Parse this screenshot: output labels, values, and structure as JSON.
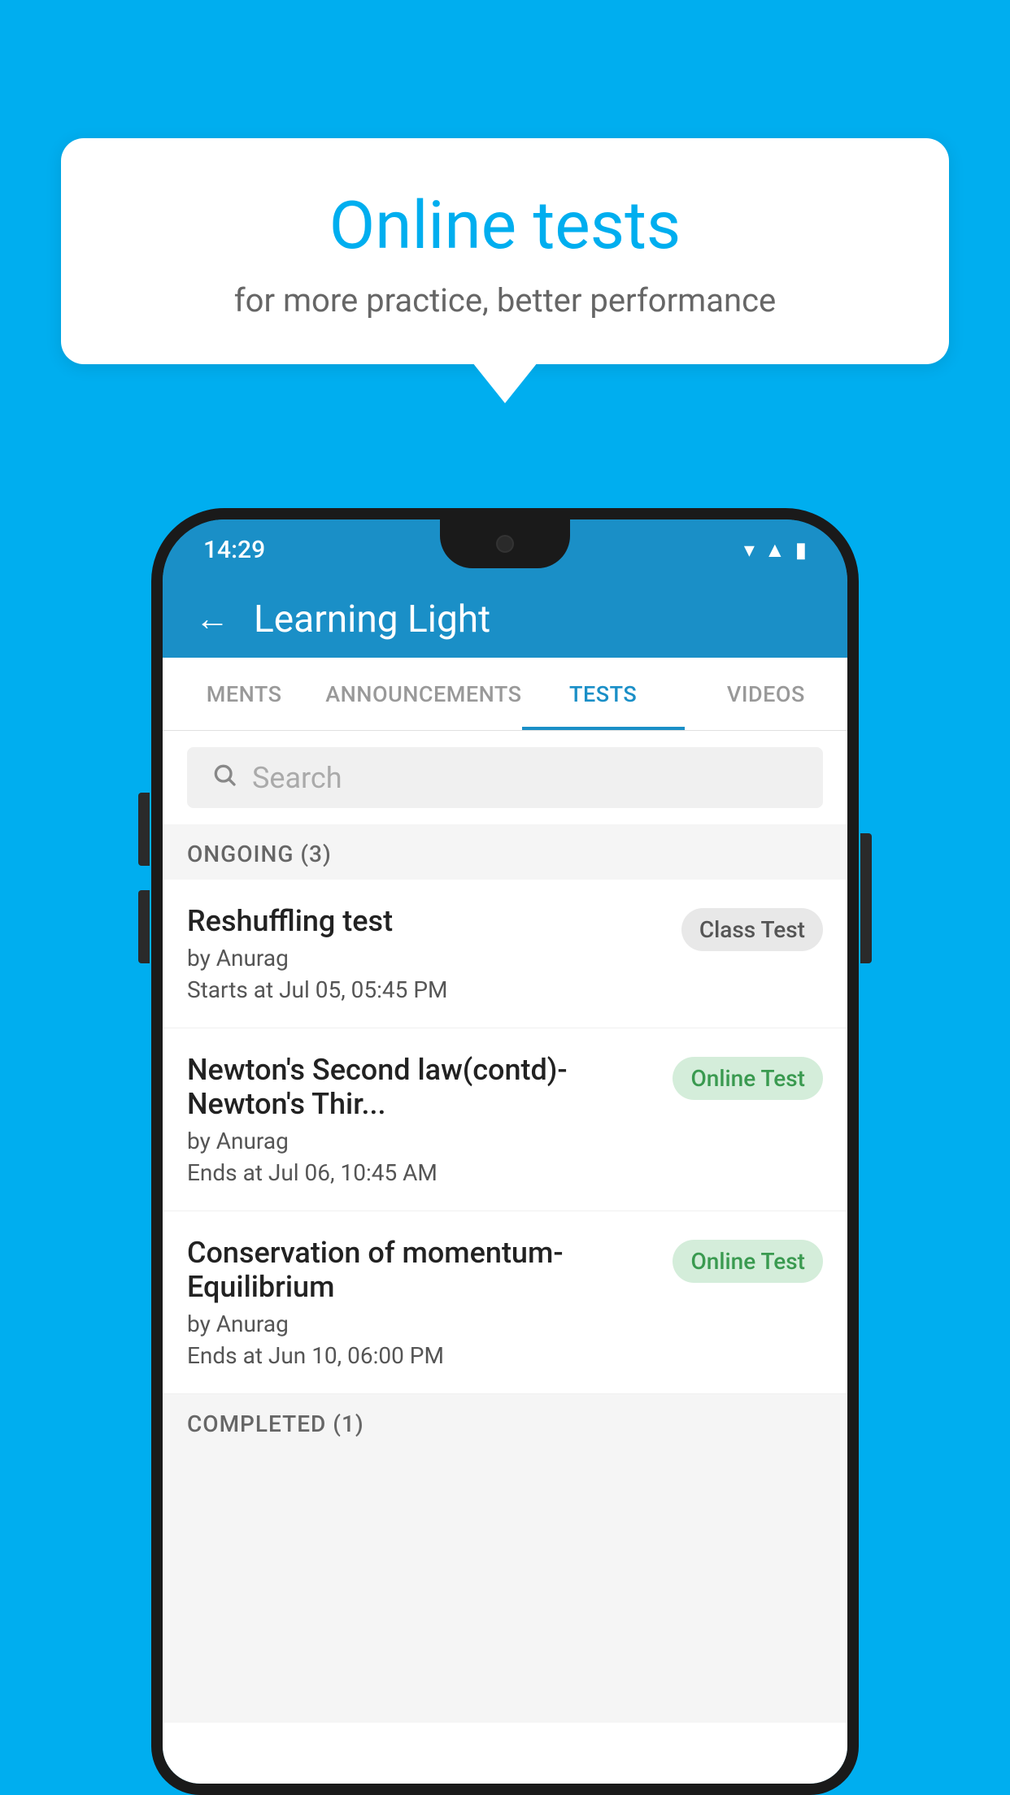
{
  "background": {
    "color": "#00AEEF"
  },
  "speechBubble": {
    "title": "Online tests",
    "subtitle": "for more practice, better performance"
  },
  "phone": {
    "statusBar": {
      "time": "14:29",
      "icons": [
        "wifi",
        "signal",
        "battery"
      ]
    },
    "header": {
      "title": "Learning Light",
      "backLabel": "←"
    },
    "tabs": [
      {
        "label": "MENTS",
        "active": false
      },
      {
        "label": "ANNOUNCEMENTS",
        "active": false
      },
      {
        "label": "TESTS",
        "active": true
      },
      {
        "label": "VIDEOS",
        "active": false
      }
    ],
    "searchPlaceholder": "Search",
    "ongoingSection": {
      "label": "ONGOING (3)",
      "tests": [
        {
          "name": "Reshuffling test",
          "by": "by Anurag",
          "time": "Starts at  Jul 05, 05:45 PM",
          "badge": "Class Test",
          "badgeType": "class"
        },
        {
          "name": "Newton's Second law(contd)-Newton's Thir...",
          "by": "by Anurag",
          "time": "Ends at  Jul 06, 10:45 AM",
          "badge": "Online Test",
          "badgeType": "online"
        },
        {
          "name": "Conservation of momentum-Equilibrium",
          "by": "by Anurag",
          "time": "Ends at  Jun 10, 06:00 PM",
          "badge": "Online Test",
          "badgeType": "online"
        }
      ]
    },
    "completedSection": {
      "label": "COMPLETED (1)"
    }
  }
}
